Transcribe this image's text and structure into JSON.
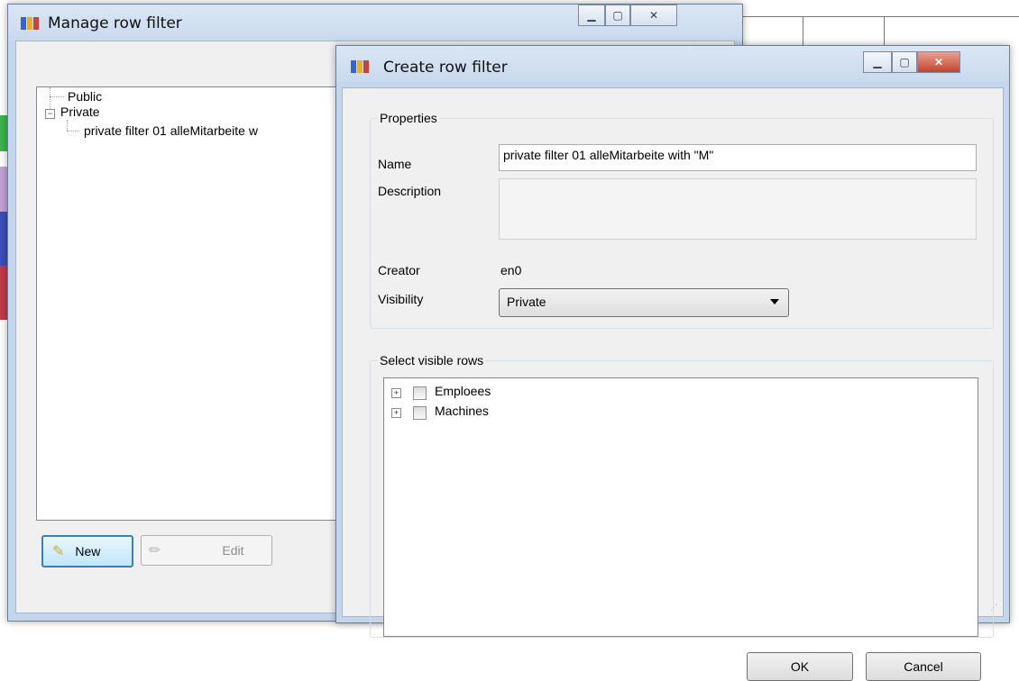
{
  "background": {
    "accent_colors": [
      "#3cb44a",
      "#c2a0d8",
      "#3a4fb8",
      "#c23a4a"
    ]
  },
  "manage_window": {
    "title": "Manage row filter",
    "tree": {
      "public_label": "Public",
      "private_label": "Private",
      "private_items": [
        "private filter 01 alleMitarbeite w"
      ]
    },
    "buttons": {
      "new_label": "New",
      "edit_label": "Edit"
    }
  },
  "create_window": {
    "title": "Create row filter",
    "properties": {
      "group_label": "Properties",
      "name_label": "Name",
      "name_value": "private filter 01 alleMitarbeite with \"M\"",
      "description_label": "Description",
      "description_value": "",
      "creator_label": "Creator",
      "creator_value": "en0",
      "visibility_label": "Visibility",
      "visibility_value": "Private"
    },
    "rows": {
      "group_label": "Select visible rows",
      "items": [
        "Emploees",
        "Machines"
      ]
    },
    "buttons": {
      "ok_label": "OK",
      "cancel_label": "Cancel"
    }
  }
}
